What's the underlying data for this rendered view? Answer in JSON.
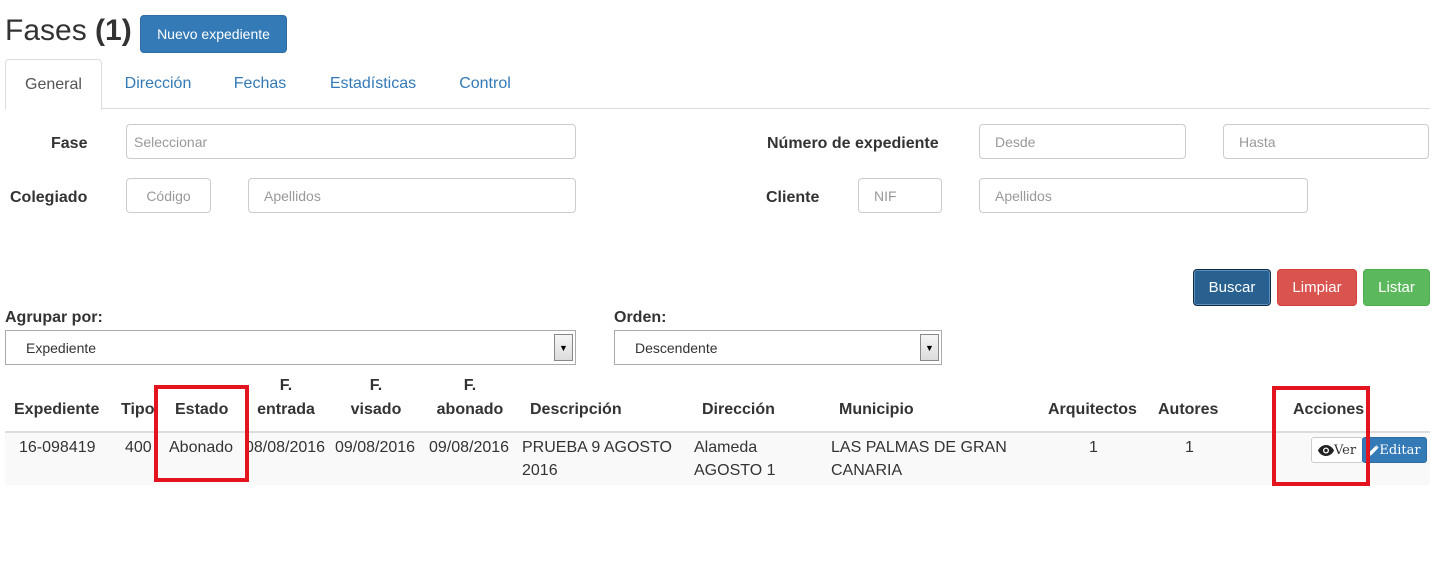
{
  "header": {
    "title": "Fases",
    "count": "(1)",
    "new_button": "Nuevo expediente"
  },
  "tabs": [
    "General",
    "Dirección",
    "Fechas",
    "Estadísticas",
    "Control"
  ],
  "filters": {
    "fase_label": "Fase",
    "fase_placeholder": "Seleccionar",
    "colegiado_label": "Colegiado",
    "colegiado_codigo_placeholder": "Código",
    "colegiado_apellidos_placeholder": "Apellidos",
    "numero_label": "Número de expediente",
    "numero_desde_placeholder": "Desde",
    "numero_hasta_placeholder": "Hasta",
    "cliente_label": "Cliente",
    "cliente_nif_placeholder": "NIF",
    "cliente_apellidos_placeholder": "Apellidos"
  },
  "actions": {
    "buscar": "Buscar",
    "limpiar": "Limpiar",
    "listar": "Listar"
  },
  "grouping": {
    "agrupar_label": "Agrupar por:",
    "agrupar_value": "Expediente",
    "orden_label": "Orden:",
    "orden_value": "Descendente"
  },
  "table": {
    "headers": {
      "expediente": "Expediente",
      "tipo": "Tipo",
      "estado": "Estado",
      "f_entrada_1": "F.",
      "f_entrada_2": "entrada",
      "f_visado_1": "F.",
      "f_visado_2": "visado",
      "f_abonado_1": "F.",
      "f_abonado_2": "abonado",
      "descripcion": "Descripción",
      "direccion": "Dirección",
      "municipio": "Municipio",
      "arquitectos": "Arquitectos",
      "autores": "Autores",
      "acciones": "Acciones"
    },
    "rows": [
      {
        "expediente": "16-098419",
        "tipo": "400",
        "estado": "Abonado",
        "f_entrada": "08/08/2016",
        "f_visado": "09/08/2016",
        "f_abonado": "09/08/2016",
        "descripcion_1": "PRUEBA 9 AGOSTO",
        "descripcion_2": "2016",
        "direccion_1": "Alameda",
        "direccion_2": "AGOSTO 1",
        "municipio_1": "LAS PALMAS DE GRAN",
        "municipio_2": "CANARIA",
        "arquitectos": "1",
        "autores": "1",
        "ver": "Ver",
        "editar": "Editar"
      }
    ]
  },
  "icons": {
    "ver_icon": "eye-icon",
    "editar_icon": "pencil-icon",
    "select_icon": "chevron-down-icon"
  },
  "colors": {
    "primary": "#337ab7",
    "danger": "#d9534f",
    "success": "#5cb85c",
    "highlight": "#e3141e"
  }
}
